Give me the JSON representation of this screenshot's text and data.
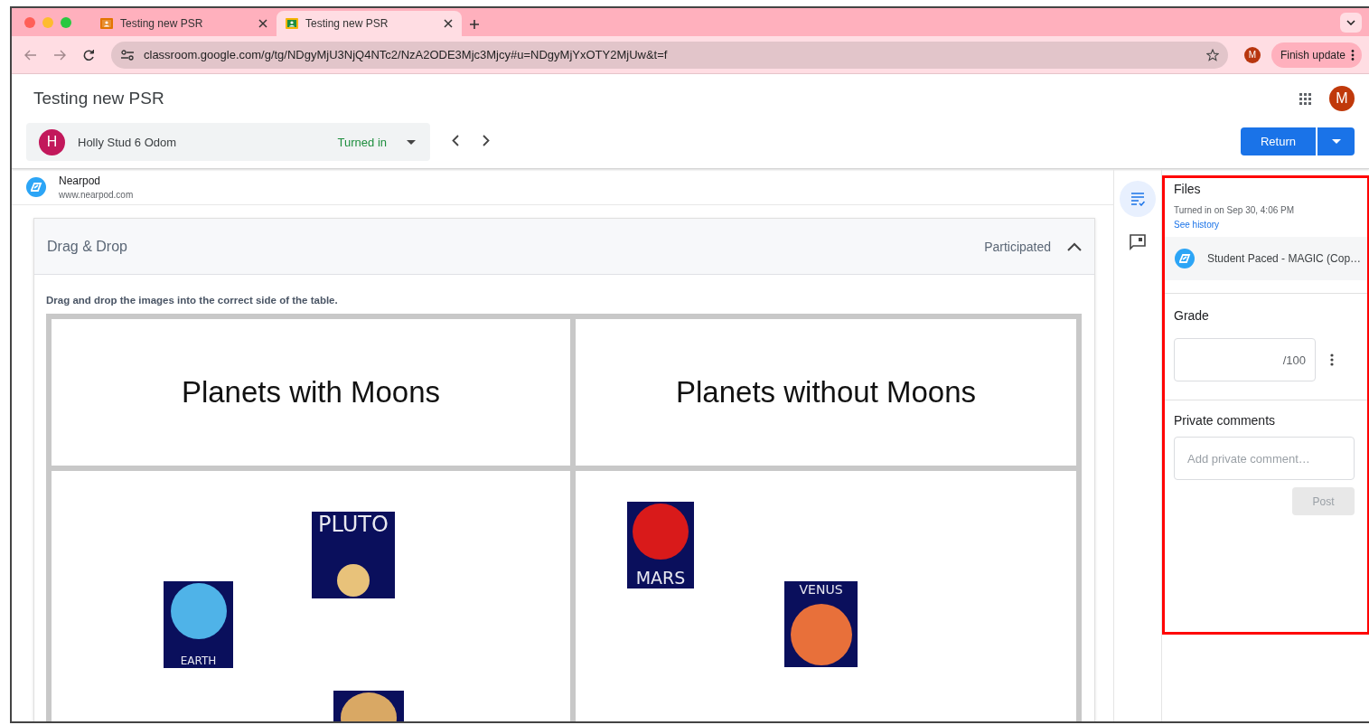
{
  "browser": {
    "tabs": [
      {
        "title": "Testing new PSR",
        "selected": false
      },
      {
        "title": "Testing new PSR",
        "selected": true
      }
    ],
    "url": "classroom.google.com/g/tg/NDgyMjU3NjQ4NTc2/NzA2ODE3Mjc3Mjcy#u=NDgyMjYxOTY2MjUw&t=f",
    "profile": "M",
    "update_button": "Finish update"
  },
  "page": {
    "title": "Testing new PSR",
    "avatar": "M",
    "return_button": "Return"
  },
  "student": {
    "initial": "H",
    "name": "Holly Stud 6 Odom",
    "status": "Turned in"
  },
  "attachment": {
    "name": "Nearpod",
    "url": "www.nearpod.com"
  },
  "activity": {
    "title": "Drag & Drop",
    "status": "Participated",
    "expanded": true,
    "instruction": "Drag and drop the images into the correct side of the table.",
    "columns": [
      {
        "heading": "Planets with Moons",
        "items": [
          {
            "label": "PLUTO",
            "color": "#e8c27a"
          },
          {
            "label": "EARTH",
            "color": "#4fb3e8"
          },
          {
            "color": "#d9a864"
          }
        ]
      },
      {
        "heading": "Planets without Moons",
        "items": [
          {
            "label": "MARS",
            "color": "#d91a1a"
          },
          {
            "label": "VENUS",
            "color": "#e8703a"
          }
        ]
      }
    ]
  },
  "rail": [
    {
      "kind": "files",
      "selected": true
    },
    {
      "kind": "comments",
      "selected": false
    }
  ],
  "panel": {
    "files_title": "Files",
    "turned_in": "Turned in on Sep 30, 4:06 PM",
    "see_history": "See history",
    "file_name": "Student Paced - MAGIC (Cop…",
    "grade_label": "Grade",
    "grade_max": "/100",
    "comments_label": "Private comments",
    "comment_placeholder": "Add private comment…",
    "post_button": {
      "label": "Post",
      "disabled": true
    }
  },
  "annotation": {
    "kind": "frame"
  }
}
